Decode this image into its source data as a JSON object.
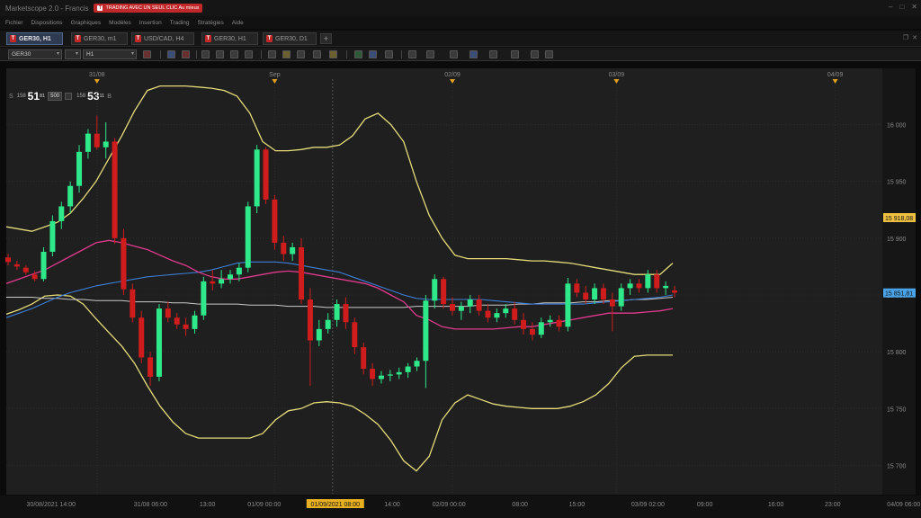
{
  "window": {
    "app_title": "Marketscope 2.0 - Francis",
    "promo_badge": "TRADING AVEC UN SEUL CLIC Au mieux",
    "controls": [
      "–",
      "□",
      "✕"
    ]
  },
  "menu": {
    "items": [
      "Fichier",
      "Dispositions",
      "Graphiques",
      "Modèles",
      "Insertion",
      "Trading",
      "Stratégies",
      "Aide"
    ]
  },
  "tabs": [
    {
      "label": "GER30, H1",
      "active": true
    },
    {
      "label": "GER30, m1",
      "active": false
    },
    {
      "label": "USD/CAD, H4",
      "active": false
    },
    {
      "label": "GER30, H1",
      "active": false
    },
    {
      "label": "GER30, D1",
      "active": false
    }
  ],
  "tab_add": "+",
  "toolbar": {
    "instrument": "GER30",
    "timeframe": "H1"
  },
  "quote": {
    "sell_label": "S",
    "sell_prefix": "158",
    "sell_big": "51",
    "sell_sup": "81",
    "lot": "500",
    "buy_prefix": "158",
    "buy_big": "53",
    "buy_sup": "11",
    "buy_label": "B"
  },
  "colors": {
    "bull": "#2ee88a",
    "bear": "#cf1d1d",
    "bollinger": "#e6dd7a",
    "ma_fast": "#e03a8c",
    "ma_slow": "#3d7fd6",
    "ma_long": "#c9c9c9",
    "price_tag_yellow": "#f0c040",
    "price_tag_blue": "#4aa3e8"
  },
  "chart_data": {
    "type": "candlestick",
    "instrument": "GER30",
    "timeframe": "H1",
    "ylim": [
      15675,
      16040
    ],
    "y_ticks": [
      "16 000",
      "15 950",
      "15 900",
      "15 850",
      "15 800",
      "15 750",
      "15 700"
    ],
    "y_tick_values": [
      16000,
      15950,
      15900,
      15850,
      15800,
      15750,
      15700
    ],
    "price_tags": [
      {
        "label": "15 918,08",
        "value": 15918.08,
        "color": "yellow"
      },
      {
        "label": "15 851,81",
        "value": 15851.81,
        "color": "blue"
      }
    ],
    "top_dates": [
      {
        "label": "31/08",
        "bar": 4
      },
      {
        "label": "Sep",
        "bar": 17
      },
      {
        "label": "02/09",
        "bar": 30
      },
      {
        "label": "03/09",
        "bar": 42
      },
      {
        "label": "04/09",
        "bar": 58
      }
    ],
    "x_ticks": [
      {
        "label": "30/08/2021 14:00",
        "bar": 1
      },
      {
        "label": "31/08 06:00",
        "bar": 8
      },
      {
        "label": "13:00",
        "bar": 12
      },
      {
        "label": "01/09 00:00",
        "bar": 16
      },
      {
        "label": "01/09/2021 08:00",
        "bar": 21,
        "highlight": true
      },
      {
        "label": "14:00",
        "bar": 25
      },
      {
        "label": "02/09 00:00",
        "bar": 29
      },
      {
        "label": "08:00",
        "bar": 34
      },
      {
        "label": "15:00",
        "bar": 38
      },
      {
        "label": "03/09 02:00",
        "bar": 43
      },
      {
        "label": "09:00",
        "bar": 47
      },
      {
        "label": "16:00",
        "bar": 52
      },
      {
        "label": "23:00",
        "bar": 56
      },
      {
        "label": "04/09 06:00",
        "bar": 61
      }
    ],
    "crosshair_bar": 21,
    "candles": [
      [
        15883,
        15886,
        15876,
        15879
      ],
      [
        15877,
        15880,
        15872,
        15875
      ],
      [
        15874,
        15876,
        15868,
        15870
      ],
      [
        15868,
        15871,
        15862,
        15864
      ],
      [
        15864,
        15892,
        15862,
        15888
      ],
      [
        15888,
        15920,
        15884,
        15915
      ],
      [
        15915,
        15932,
        15908,
        15928
      ],
      [
        15928,
        15950,
        15922,
        15946
      ],
      [
        15946,
        15982,
        15940,
        15976
      ],
      [
        15976,
        15996,
        15970,
        15992
      ],
      [
        15992,
        16008,
        15978,
        15980
      ],
      [
        15980,
        16002,
        15970,
        15985
      ],
      [
        15985,
        15988,
        15895,
        15900
      ],
      [
        15900,
        15908,
        15850,
        15855
      ],
      [
        15855,
        15860,
        15826,
        15830
      ],
      [
        15830,
        15836,
        15790,
        15795
      ],
      [
        15795,
        15800,
        15770,
        15778
      ],
      [
        15778,
        15842,
        15774,
        15838
      ],
      [
        15838,
        15844,
        15826,
        15830
      ],
      [
        15830,
        15834,
        15820,
        15824
      ],
      [
        15824,
        15830,
        15814,
        15820
      ],
      [
        15820,
        15836,
        15816,
        15832
      ],
      [
        15832,
        15866,
        15828,
        15862
      ],
      [
        15862,
        15872,
        15854,
        15860
      ],
      [
        15860,
        15872,
        15856,
        15864
      ],
      [
        15864,
        15872,
        15860,
        15868
      ],
      [
        15868,
        15878,
        15862,
        15874
      ],
      [
        15874,
        15932,
        15870,
        15928
      ],
      [
        15928,
        15982,
        15922,
        15978
      ],
      [
        15978,
        15980,
        15930,
        15934
      ],
      [
        15934,
        15938,
        15890,
        15896
      ],
      [
        15896,
        15902,
        15880,
        15886
      ],
      [
        15886,
        15896,
        15880,
        15892
      ],
      [
        15892,
        15900,
        15842,
        15846
      ],
      [
        15846,
        15856,
        15770,
        15810
      ],
      [
        15810,
        15828,
        15805,
        15820
      ],
      [
        15820,
        15834,
        15816,
        15828
      ],
      [
        15828,
        15846,
        15822,
        15842
      ],
      [
        15842,
        15848,
        15820,
        15826
      ],
      [
        15826,
        15830,
        15798,
        15804
      ],
      [
        15804,
        15808,
        15780,
        15785
      ],
      [
        15785,
        15790,
        15770,
        15776
      ],
      [
        15776,
        15783,
        15772,
        15779
      ],
      [
        15779,
        15784,
        15774,
        15780
      ],
      [
        15780,
        15786,
        15776,
        15782
      ],
      [
        15782,
        15790,
        15777,
        15787
      ],
      [
        15787,
        15795,
        15783,
        15792
      ],
      [
        15792,
        15850,
        15768,
        15845
      ],
      [
        15845,
        15868,
        15838,
        15864
      ],
      [
        15864,
        15866,
        15838,
        15842
      ],
      [
        15842,
        15848,
        15832,
        15836
      ],
      [
        15836,
        15844,
        15828,
        15840
      ],
      [
        15840,
        15850,
        15834,
        15846
      ],
      [
        15846,
        15850,
        15832,
        15836
      ],
      [
        15836,
        15842,
        15826,
        15830
      ],
      [
        15830,
        15838,
        15826,
        15834
      ],
      [
        15834,
        15842,
        15830,
        15838
      ],
      [
        15838,
        15844,
        15824,
        15828
      ],
      [
        15828,
        15834,
        15815,
        15820
      ],
      [
        15820,
        15826,
        15810,
        15815
      ],
      [
        15815,
        15830,
        15812,
        15826
      ],
      [
        15826,
        15832,
        15822,
        15828
      ],
      [
        15828,
        15832,
        15818,
        15822
      ],
      [
        15822,
        15865,
        15818,
        15860
      ],
      [
        15860,
        15864,
        15848,
        15852
      ],
      [
        15852,
        15858,
        15842,
        15846
      ],
      [
        15846,
        15860,
        15842,
        15856
      ],
      [
        15856,
        15860,
        15842,
        15846
      ],
      [
        15846,
        15852,
        15818,
        15840
      ],
      [
        15840,
        15860,
        15836,
        15856
      ],
      [
        15856,
        15864,
        15850,
        15860
      ],
      [
        15860,
        15864,
        15852,
        15856
      ],
      [
        15856,
        15872,
        15852,
        15868
      ],
      [
        15868,
        15872,
        15852,
        15856
      ],
      [
        15856,
        15862,
        15850,
        15858
      ],
      [
        15854,
        15858,
        15848,
        15852
      ]
    ],
    "bollinger_upper": [
      15910,
      15908,
      15906,
      15910,
      15914,
      15922,
      15935,
      15950,
      15970,
      15990,
      16012,
      16030,
      16034,
      16034,
      16034,
      16033,
      16032,
      16030,
      16025,
      16010,
      15985,
      15977,
      15977,
      15978,
      15980,
      15980,
      15982,
      15990,
      16005,
      16010,
      16000,
      15985,
      15950,
      15920,
      15900,
      15885,
      15882,
      15882,
      15882,
      15882,
      15881,
      15880,
      15880,
      15879,
      15878,
      15876,
      15874,
      15872,
      15870,
      15868,
      15868,
      15868,
      15878
    ],
    "bollinger_lower": [
      15833,
      15837,
      15842,
      15849,
      15850,
      15849,
      15842,
      15829,
      15817,
      15805,
      15790,
      15770,
      15752,
      15738,
      15728,
      15724,
      15724,
      15724,
      15724,
      15724,
      15728,
      15740,
      15748,
      15750,
      15755,
      15756,
      15755,
      15752,
      15745,
      15736,
      15722,
      15704,
      15695,
      15708,
      15740,
      15755,
      15762,
      15758,
      15754,
      15752,
      15751,
      15750,
      15750,
      15750,
      15752,
      15756,
      15762,
      15772,
      15786,
      15796,
      15797,
      15797,
      15797
    ],
    "ma_fast": [
      15860,
      15864,
      15868,
      15872,
      15878,
      15884,
      15890,
      15896,
      15898,
      15896,
      15893,
      15890,
      15885,
      15880,
      15876,
      15870,
      15866,
      15864,
      15864,
      15866,
      15868,
      15870,
      15871,
      15870,
      15868,
      15866,
      15864,
      15862,
      15860,
      15856,
      15850,
      15844,
      15832,
      15828,
      15822,
      15820,
      15820,
      15820,
      15820,
      15821,
      15822,
      15822,
      15824,
      15826,
      15828,
      15830,
      15832,
      15834,
      15834,
      15834,
      15835,
      15836,
      15838
    ],
    "ma_slow": [
      15830,
      15834,
      15838,
      15843,
      15848,
      15852,
      15855,
      15858,
      15860,
      15862,
      15864,
      15866,
      15867,
      15868,
      15869,
      15870,
      15872,
      15875,
      15878,
      15879,
      15879,
      15879,
      15878,
      15876,
      15874,
      15872,
      15870,
      15866,
      15862,
      15858,
      15854,
      15850,
      15847,
      15846,
      15846,
      15846,
      15846,
      15846,
      15845,
      15844,
      15843,
      15842,
      15842,
      15842,
      15842,
      15842,
      15843,
      15844,
      15845,
      15846,
      15847,
      15848,
      15850
    ],
    "ma_long": [
      15848,
      15848,
      15848,
      15847,
      15847,
      15846,
      15846,
      15845,
      15845,
      15845,
      15844,
      15844,
      15844,
      15843,
      15843,
      15842,
      15842,
      15842,
      15842,
      15841,
      15841,
      15841,
      15840,
      15840,
      15840,
      15839,
      15839,
      15839,
      15839,
      15839,
      15839,
      15839,
      15840,
      15840,
      15840,
      15840,
      15840,
      15841,
      15841,
      15841,
      15842,
      15842,
      15843,
      15843,
      15843,
      15844,
      15844,
      15845,
      15845,
      15846,
      15846,
      15847,
      15848
    ]
  }
}
